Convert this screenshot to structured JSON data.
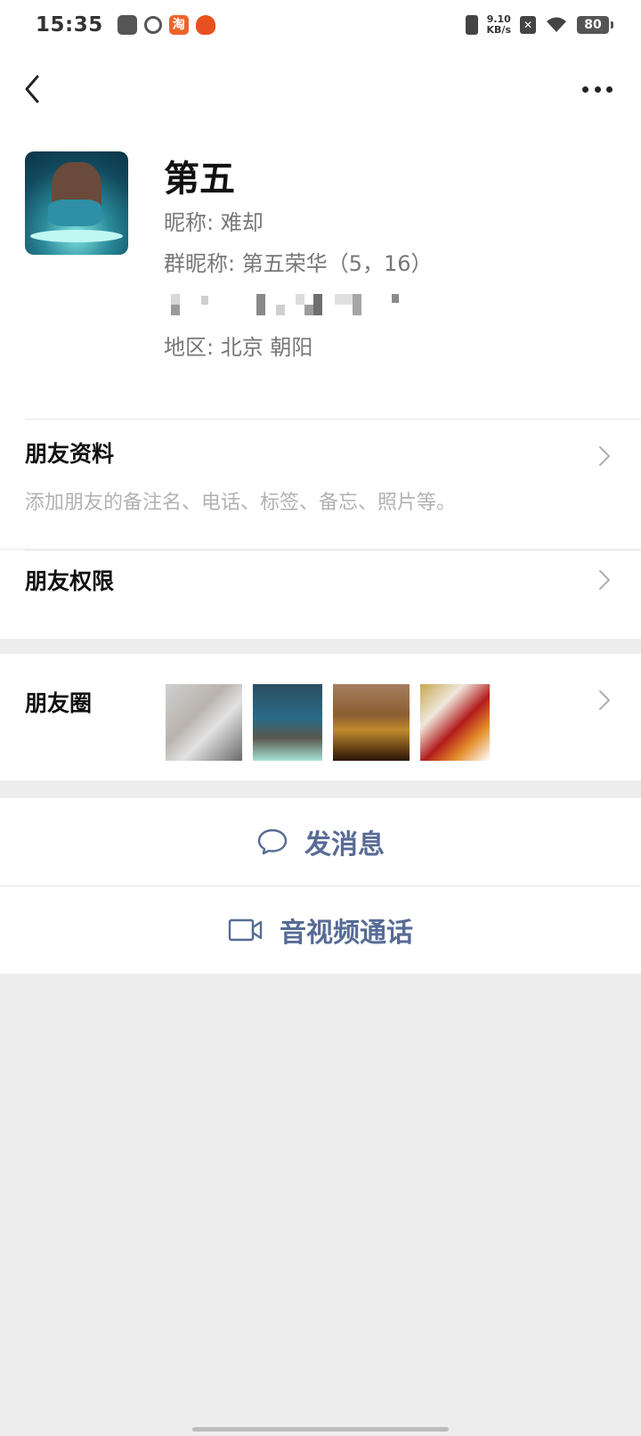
{
  "status_bar": {
    "time": "15:35",
    "net_speed_value": "9.10",
    "net_speed_unit": "KB/s",
    "battery": "80",
    "taobao_glyph": "淘",
    "icons": [
      "bag-icon",
      "swirl-icon",
      "taobao-icon",
      "cat-icon",
      "vibrate-icon",
      "no-sim-icon",
      "wifi-icon",
      "battery-icon"
    ]
  },
  "nav": {
    "back_icon": "chevron-left-icon",
    "more_icon": "more-dots-icon"
  },
  "profile": {
    "name": "第五",
    "nickname": "昵称: 难却",
    "group_nickname": "群昵称: 第五荣华（5，16）",
    "region": "地区: 北京  朝阳"
  },
  "rows": {
    "profile_info": {
      "title": "朋友资料",
      "subtitle": "添加朋友的备注名、电话、标签、备忘、照片等。"
    },
    "permissions": {
      "title": "朋友权限"
    },
    "moments": {
      "title": "朋友圈"
    }
  },
  "actions": {
    "message": "发消息",
    "call": "音视频通话"
  },
  "colors": {
    "link_blue": "#576b95",
    "background": "#ededed",
    "card": "#ffffff",
    "subtle_text": "#b2b2b2"
  }
}
